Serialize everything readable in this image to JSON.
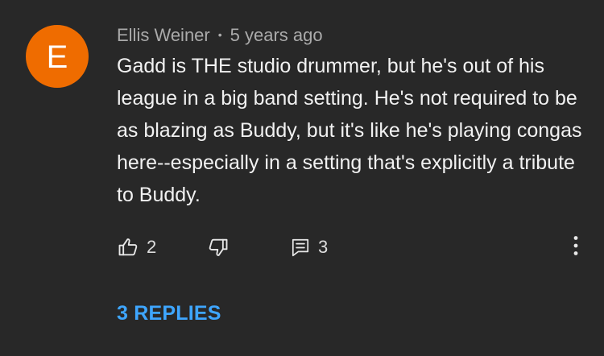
{
  "comment": {
    "avatar_letter": "E",
    "author": "Ellis Weiner",
    "separator": "•",
    "timestamp": "5 years ago",
    "text": "Gadd is THE studio drummer, but he's out of his league in a big band setting. He's not required to be as blazing as Buddy, but it's like he's playing congas here--especially in a setting that's explicitly a tribute to Buddy.",
    "like_count": "2",
    "reply_count": "3",
    "replies_label": "3 REPLIES"
  },
  "colors": {
    "background": "#282828",
    "avatar": "#ef6c00",
    "link": "#3ea6ff",
    "text": "#f1f1f1",
    "meta": "#aaaaaa"
  },
  "icons": {
    "like": "thumbs-up-icon",
    "dislike": "thumbs-down-icon",
    "reply": "comment-icon",
    "more": "more-vertical-icon"
  }
}
